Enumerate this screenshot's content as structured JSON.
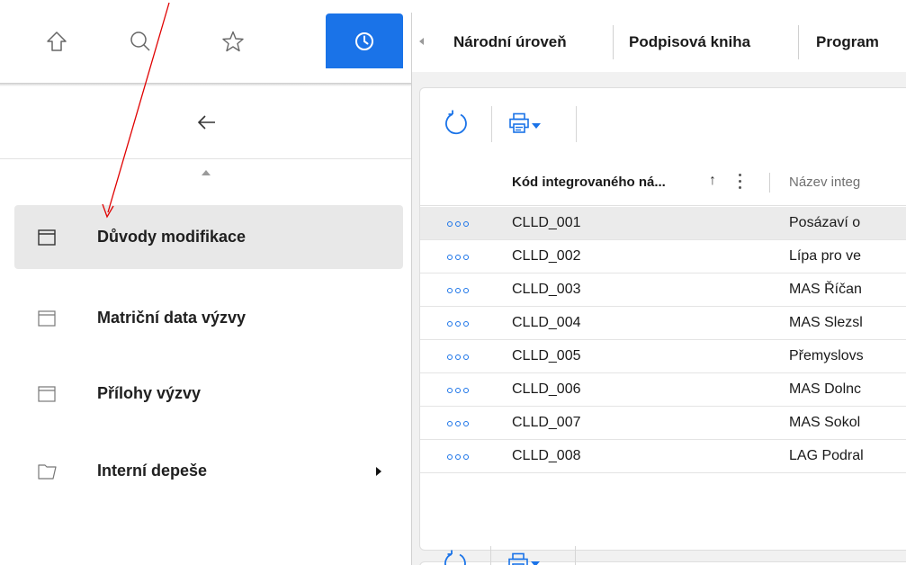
{
  "nav_icons": {
    "home": "home-icon",
    "search": "search-icon",
    "favorites": "star-icon",
    "history": "clock-icon"
  },
  "colors": {
    "accent": "#1a73e8",
    "annotation": "#e00000",
    "selected_bg": "#e8e8e8"
  },
  "sidebar": {
    "back_icon": "arrow-left-icon",
    "scroll_up_icon": "triangle-up-icon",
    "items": [
      {
        "label": "Důvody modifikace",
        "icon": "window-icon",
        "active": true
      },
      {
        "label": "Matriční data výzvy",
        "icon": "window-icon",
        "active": false
      },
      {
        "label": "Přílohy výzvy",
        "icon": "window-icon",
        "active": false
      },
      {
        "label": "Interní depeše",
        "icon": "folder-icon",
        "active": false,
        "has_submenu": true
      }
    ]
  },
  "tabs": [
    {
      "label": "Národní úroveň"
    },
    {
      "label": "Podpisová kniha"
    },
    {
      "label": "Program"
    }
  ],
  "toolbar": {
    "refresh_icon": "refresh-icon",
    "print_icon": "print-icon"
  },
  "grid": {
    "columns": [
      {
        "label": "Kód integrovaného ná...",
        "sort": "ascending"
      },
      {
        "label": "Název integ"
      }
    ],
    "rows": [
      {
        "code": "CLLD_001",
        "name": "Posázaví o",
        "selected": true
      },
      {
        "code": "CLLD_002",
        "name": "Lípa pro ve",
        "selected": false
      },
      {
        "code": "CLLD_003",
        "name": "MAS Říčan",
        "selected": false
      },
      {
        "code": "CLLD_004",
        "name": "MAS Slezsl",
        "selected": false
      },
      {
        "code": "CLLD_005",
        "name": "Přemyslovs",
        "selected": false
      },
      {
        "code": "CLLD_006",
        "name": "MAS Dolnc",
        "selected": false
      },
      {
        "code": "CLLD_007",
        "name": "MAS Sokol",
        "selected": false
      },
      {
        "code": "CLLD_008",
        "name": "LAG Podral",
        "selected": false
      }
    ]
  }
}
